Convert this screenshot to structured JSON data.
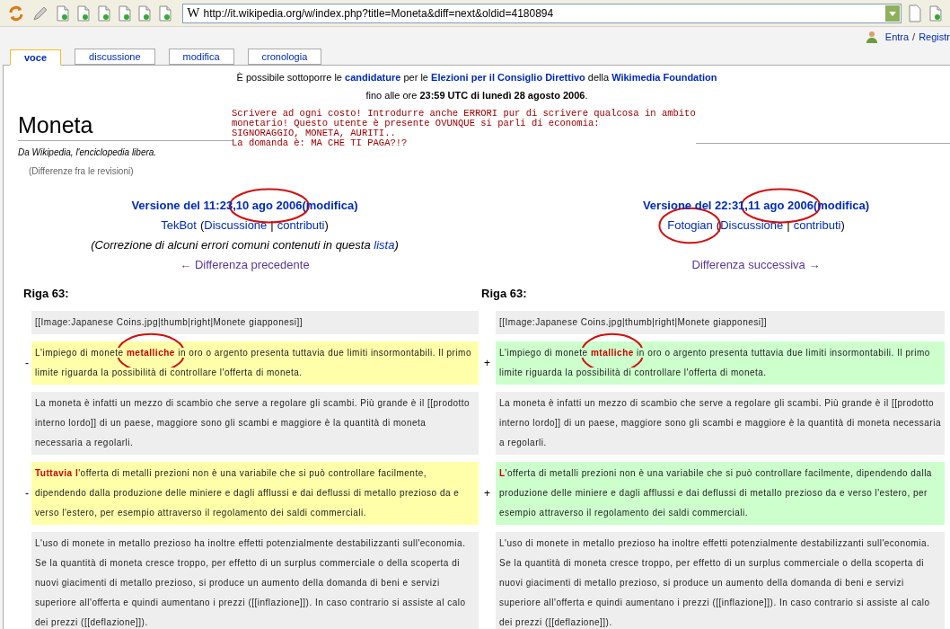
{
  "toolbar": {
    "site_icon": "W",
    "url": "http://it.wikipedia.org/w/index.php?title=Moneta&diff=next&oldid=4180894"
  },
  "user_links": [
    "Entra",
    "/",
    "Registr"
  ],
  "tabs": [
    {
      "label": "voce",
      "selected": true
    },
    {
      "label": "discussione",
      "selected": false
    },
    {
      "label": "modifica",
      "selected": false
    },
    {
      "label": "cronologia",
      "selected": false
    }
  ],
  "sitenotice": [
    [
      {
        "text": "È possibile sottoporre le ",
        "link": false
      },
      {
        "text": "candidature",
        "link": true
      },
      {
        "text": " per le ",
        "link": false
      },
      {
        "text": "Elezioni per il Consiglio Direttivo",
        "link": true
      },
      {
        "text": " della ",
        "link": false
      },
      {
        "text": "Wikimedia Foundation",
        "link": true
      }
    ],
    [
      {
        "text": "fino alle ore ",
        "link": false
      },
      {
        "text": "23:59 UTC di lunedì 28 agosto 2006",
        "link": false,
        "bold": true
      },
      {
        "text": ".",
        "link": false
      }
    ]
  ],
  "title": "Moneta",
  "tagline": "Da Wikipedia, l'enciclopedia libera.",
  "vandal_text": [
    "Scrivere ad ogni costo! Introdurre anche ERRORI pur di scrivere qualcosa in ambito",
    "monetario! Questo utente è presente OVUNQUE si parli di economia:",
    "SIGNORAGGIO, MONETA, AURITI..",
    "La domanda è: MA CHE TI PAGA?!?"
  ],
  "subtitle": "(Differenze fra le revisioni)",
  "revisions": [
    {
      "version": [
        {
          "text": "Versione del 11:23, ",
          "circled": false
        },
        {
          "text": "10 ago 2006",
          "circled": true
        },
        {
          "text": " (modifica)",
          "circled": false
        }
      ],
      "user": {
        "name": "TekBot",
        "circled": false
      },
      "open": "(",
      "talk": "Discussione",
      "sep": "|",
      "contribs": "contributi",
      "close": ")",
      "comment": "(Correzione di alcuni errori comuni contenuti in questa ",
      "comment_link": "lista",
      "comment_end": ")",
      "nav": "← Differenza precedente"
    },
    {
      "version": [
        {
          "text": "Versione del 22:31, ",
          "circled": false
        },
        {
          "text": "11 ago 2006",
          "circled": true
        },
        {
          "text": " (modifica)",
          "circled": false
        }
      ],
      "user": {
        "name": "Fotogian",
        "circled": true
      },
      "open": "(",
      "talk": "Discussione",
      "sep": "|",
      "contribs": "contributi",
      "close": ")",
      "nav": "Differenza successiva →"
    }
  ],
  "line_headers": [
    "Riga 63:",
    "Riga 63:"
  ],
  "diff_rows": [
    {
      "kind": "context",
      "left": [
        {
          "text": "[[Image:Japanese Coins.jpg|thumb|right|Monete giapponesi]]",
          "changed": false
        }
      ],
      "right": [
        {
          "text": "[[Image:Japanese Coins.jpg|thumb|right|Monete giapponesi]]",
          "changed": false
        }
      ]
    },
    {
      "kind": "change",
      "left_marker": "-",
      "right_marker": "+",
      "left": [
        {
          "text": "L'impiego di monete ",
          "changed": false
        },
        {
          "text": "metalliche",
          "changed": true,
          "circled": true
        },
        {
          "text": " in oro o argento presenta tuttavia due limiti insormontabili. Il primo limite riguarda la possibilità di controllare l'offerta di moneta.",
          "changed": false
        }
      ],
      "right": [
        {
          "text": "L'impiego di monete ",
          "changed": false
        },
        {
          "text": "mtalliche",
          "changed": true,
          "circled": true
        },
        {
          "text": " in oro o argento presenta tuttavia due limiti insormontabili. Il primo limite riguarda la possibilità di controllare l'offerta di moneta.",
          "changed": false
        }
      ]
    },
    {
      "kind": "context",
      "left": [
        {
          "text": "La moneta è infatti un mezzo di scambio che serve a regolare gli scambi. Più grande è il [[prodotto interno lordo]] di un paese, maggiore sono gli scambi e maggiore è la quantità di moneta necessaria a regolarli.",
          "changed": false
        }
      ],
      "right": [
        {
          "text": "La moneta è infatti un mezzo di scambio che serve a regolare gli scambi. Più grande è il [[prodotto interno lordo]] di un paese, maggiore sono gli scambi e maggiore è la quantità di moneta necessaria a regolarli.",
          "changed": false
        }
      ]
    },
    {
      "kind": "change",
      "left_marker": "-",
      "right_marker": "+",
      "left": [
        {
          "text": "Tuttavia l",
          "changed": true
        },
        {
          "text": "'offerta di metalli prezioni non è una variabile che si può controllare facilmente, dipendendo dalla produzione delle miniere e dagli afflussi e dai deflussi di metallo prezioso da e verso l'estero, per esempio attraverso il regolamento dei saldi commerciali.",
          "changed": false
        }
      ],
      "right": [
        {
          "text": "L",
          "changed": true
        },
        {
          "text": "'offerta di metalli prezioni non è una variabile che si può controllare facilmente, dipendendo dalla produzione delle miniere e dagli afflussi e dai deflussi di metallo prezioso da e verso l'estero, per esempio attraverso il regolamento dei saldi commerciali.",
          "changed": false
        }
      ]
    },
    {
      "kind": "context",
      "left": [
        {
          "text": "L'uso di monete in metallo prezioso ha inoltre effetti potenzialmente destabilizzanti sull'economia. Se la quantità di moneta cresce troppo, per effetto di un surplus commerciale o della scoperta di nuovi giacimenti di metallo prezioso, si produce un aumento della domanda di beni e servizi superiore all'offerta e quindi aumentano i prezzi ([[inflazione]]). In caso contrario si assiste al calo dei prezzi ([[deflazione]]).",
          "changed": false
        }
      ],
      "right": [
        {
          "text": "L'uso di monete in metallo prezioso ha inoltre effetti potenzialmente destabilizzanti sull'economia. Se la quantità di moneta cresce troppo, per effetto di un surplus commerciale o della scoperta di nuovi giacimenti di metallo prezioso, si produce un aumento della domanda di beni e servizi superiore all'offerta e quindi aumentano i prezzi ([[inflazione]]). In caso contrario si assiste al calo dei prezzi ([[deflazione]]).",
          "changed": false
        }
      ]
    }
  ]
}
